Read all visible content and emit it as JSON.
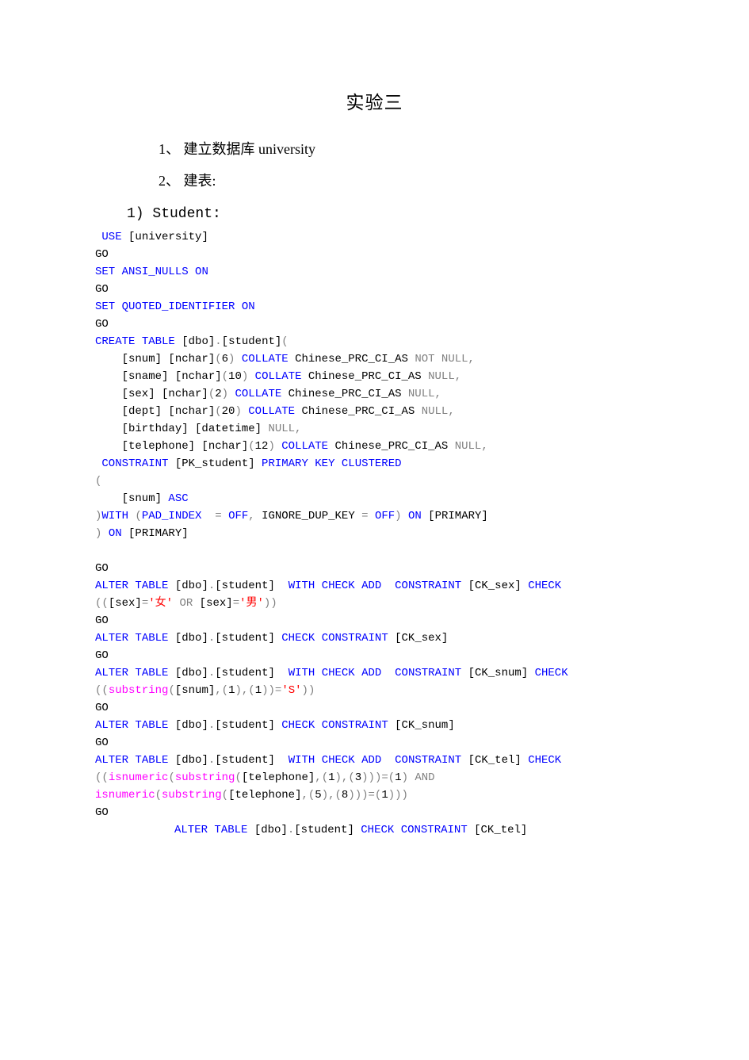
{
  "title": "实验三",
  "items": [
    "1、 建立数据库 university",
    "2、 建表:"
  ],
  "sub": "1) Student:",
  "code": [
    [
      {
        "c": "blk",
        "t": " "
      },
      {
        "c": "kw",
        "t": "USE"
      },
      {
        "c": "blk",
        "t": " [university]"
      }
    ],
    [
      {
        "c": "blk",
        "t": "GO"
      }
    ],
    [
      {
        "c": "kw",
        "t": "SET"
      },
      {
        "c": "blk",
        "t": " "
      },
      {
        "c": "kw",
        "t": "ANSI_NULLS"
      },
      {
        "c": "blk",
        "t": " "
      },
      {
        "c": "kw",
        "t": "ON"
      }
    ],
    [
      {
        "c": "blk",
        "t": "GO"
      }
    ],
    [
      {
        "c": "kw",
        "t": "SET"
      },
      {
        "c": "blk",
        "t": " "
      },
      {
        "c": "kw",
        "t": "QUOTED_IDENTIFIER"
      },
      {
        "c": "blk",
        "t": " "
      },
      {
        "c": "kw",
        "t": "ON"
      }
    ],
    [
      {
        "c": "blk",
        "t": "GO"
      }
    ],
    [
      {
        "c": "kw",
        "t": "CREATE"
      },
      {
        "c": "blk",
        "t": " "
      },
      {
        "c": "kw",
        "t": "TABLE"
      },
      {
        "c": "blk",
        "t": " [dbo]"
      },
      {
        "c": "gray",
        "t": "."
      },
      {
        "c": "blk",
        "t": "[student]"
      },
      {
        "c": "gray",
        "t": "("
      }
    ],
    [
      {
        "c": "blk",
        "t": "    [snum] [nchar]"
      },
      {
        "c": "gray",
        "t": "("
      },
      {
        "c": "blk",
        "t": "6"
      },
      {
        "c": "gray",
        "t": ")"
      },
      {
        "c": "blk",
        "t": " "
      },
      {
        "c": "kw",
        "t": "COLLATE"
      },
      {
        "c": "blk",
        "t": " Chinese_PRC_CI_AS "
      },
      {
        "c": "gray",
        "t": "NOT NULL,"
      }
    ],
    [
      {
        "c": "blk",
        "t": "    [sname] [nchar]"
      },
      {
        "c": "gray",
        "t": "("
      },
      {
        "c": "blk",
        "t": "10"
      },
      {
        "c": "gray",
        "t": ")"
      },
      {
        "c": "blk",
        "t": " "
      },
      {
        "c": "kw",
        "t": "COLLATE"
      },
      {
        "c": "blk",
        "t": " Chinese_PRC_CI_AS "
      },
      {
        "c": "gray",
        "t": "NULL,"
      }
    ],
    [
      {
        "c": "blk",
        "t": "    [sex] [nchar]"
      },
      {
        "c": "gray",
        "t": "("
      },
      {
        "c": "blk",
        "t": "2"
      },
      {
        "c": "gray",
        "t": ")"
      },
      {
        "c": "blk",
        "t": " "
      },
      {
        "c": "kw",
        "t": "COLLATE"
      },
      {
        "c": "blk",
        "t": " Chinese_PRC_CI_AS "
      },
      {
        "c": "gray",
        "t": "NULL,"
      }
    ],
    [
      {
        "c": "blk",
        "t": "    [dept] [nchar]"
      },
      {
        "c": "gray",
        "t": "("
      },
      {
        "c": "blk",
        "t": "20"
      },
      {
        "c": "gray",
        "t": ")"
      },
      {
        "c": "blk",
        "t": " "
      },
      {
        "c": "kw",
        "t": "COLLATE"
      },
      {
        "c": "blk",
        "t": " Chinese_PRC_CI_AS "
      },
      {
        "c": "gray",
        "t": "NULL,"
      }
    ],
    [
      {
        "c": "blk",
        "t": "    [birthday] [datetime] "
      },
      {
        "c": "gray",
        "t": "NULL,"
      }
    ],
    [
      {
        "c": "blk",
        "t": "    [telephone] [nchar]"
      },
      {
        "c": "gray",
        "t": "("
      },
      {
        "c": "blk",
        "t": "12"
      },
      {
        "c": "gray",
        "t": ")"
      },
      {
        "c": "blk",
        "t": " "
      },
      {
        "c": "kw",
        "t": "COLLATE"
      },
      {
        "c": "blk",
        "t": " Chinese_PRC_CI_AS "
      },
      {
        "c": "gray",
        "t": "NULL,"
      }
    ],
    [
      {
        "c": "blk",
        "t": " "
      },
      {
        "c": "kw",
        "t": "CONSTRAINT"
      },
      {
        "c": "blk",
        "t": " [PK_student] "
      },
      {
        "c": "kw",
        "t": "PRIMARY"
      },
      {
        "c": "blk",
        "t": " "
      },
      {
        "c": "kw",
        "t": "KEY"
      },
      {
        "c": "blk",
        "t": " "
      },
      {
        "c": "kw",
        "t": "CLUSTERED"
      }
    ],
    [
      {
        "c": "gray",
        "t": "("
      }
    ],
    [
      {
        "c": "blk",
        "t": "    [snum] "
      },
      {
        "c": "kw",
        "t": "ASC"
      }
    ],
    [
      {
        "c": "gray",
        "t": ")"
      },
      {
        "c": "kw",
        "t": "WITH"
      },
      {
        "c": "blk",
        "t": " "
      },
      {
        "c": "gray",
        "t": "("
      },
      {
        "c": "kw",
        "t": "PAD_INDEX"
      },
      {
        "c": "blk",
        "t": "  "
      },
      {
        "c": "gray",
        "t": "="
      },
      {
        "c": "blk",
        "t": " "
      },
      {
        "c": "kw",
        "t": "OFF"
      },
      {
        "c": "gray",
        "t": ","
      },
      {
        "c": "blk",
        "t": " IGNORE_DUP_KEY "
      },
      {
        "c": "gray",
        "t": "="
      },
      {
        "c": "blk",
        "t": " "
      },
      {
        "c": "kw",
        "t": "OFF"
      },
      {
        "c": "gray",
        "t": ")"
      },
      {
        "c": "blk",
        "t": " "
      },
      {
        "c": "kw",
        "t": "ON"
      },
      {
        "c": "blk",
        "t": " [PRIMARY]"
      }
    ],
    [
      {
        "c": "gray",
        "t": ")"
      },
      {
        "c": "blk",
        "t": " "
      },
      {
        "c": "kw",
        "t": "ON"
      },
      {
        "c": "blk",
        "t": " [PRIMARY]"
      }
    ],
    [
      {
        "c": "blk",
        "t": ""
      }
    ],
    [
      {
        "c": "blk",
        "t": "GO"
      }
    ],
    [
      {
        "c": "kw",
        "t": "ALTER"
      },
      {
        "c": "blk",
        "t": " "
      },
      {
        "c": "kw",
        "t": "TABLE"
      },
      {
        "c": "blk",
        "t": " [dbo]"
      },
      {
        "c": "gray",
        "t": "."
      },
      {
        "c": "blk",
        "t": "[student]  "
      },
      {
        "c": "kw",
        "t": "WITH"
      },
      {
        "c": "blk",
        "t": " "
      },
      {
        "c": "kw",
        "t": "CHECK"
      },
      {
        "c": "blk",
        "t": " "
      },
      {
        "c": "kw",
        "t": "ADD"
      },
      {
        "c": "blk",
        "t": "  "
      },
      {
        "c": "kw",
        "t": "CONSTRAINT"
      },
      {
        "c": "blk",
        "t": " [CK_sex] "
      },
      {
        "c": "kw",
        "t": "CHECK"
      }
    ],
    [
      {
        "c": "gray",
        "t": "(("
      },
      {
        "c": "blk",
        "t": "[sex]"
      },
      {
        "c": "gray",
        "t": "="
      },
      {
        "c": "str",
        "t": "'女'"
      },
      {
        "c": "blk",
        "t": " "
      },
      {
        "c": "gray",
        "t": "OR"
      },
      {
        "c": "blk",
        "t": " [sex]"
      },
      {
        "c": "gray",
        "t": "="
      },
      {
        "c": "str",
        "t": "'男'"
      },
      {
        "c": "gray",
        "t": "))"
      }
    ],
    [
      {
        "c": "blk",
        "t": "GO"
      }
    ],
    [
      {
        "c": "kw",
        "t": "ALTER"
      },
      {
        "c": "blk",
        "t": " "
      },
      {
        "c": "kw",
        "t": "TABLE"
      },
      {
        "c": "blk",
        "t": " [dbo]"
      },
      {
        "c": "gray",
        "t": "."
      },
      {
        "c": "blk",
        "t": "[student] "
      },
      {
        "c": "kw",
        "t": "CHECK"
      },
      {
        "c": "blk",
        "t": " "
      },
      {
        "c": "kw",
        "t": "CONSTRAINT"
      },
      {
        "c": "blk",
        "t": " [CK_sex]"
      }
    ],
    [
      {
        "c": "blk",
        "t": "GO"
      }
    ],
    [
      {
        "c": "kw",
        "t": "ALTER"
      },
      {
        "c": "blk",
        "t": " "
      },
      {
        "c": "kw",
        "t": "TABLE"
      },
      {
        "c": "blk",
        "t": " [dbo]"
      },
      {
        "c": "gray",
        "t": "."
      },
      {
        "c": "blk",
        "t": "[student]  "
      },
      {
        "c": "kw",
        "t": "WITH"
      },
      {
        "c": "blk",
        "t": " "
      },
      {
        "c": "kw",
        "t": "CHECK"
      },
      {
        "c": "blk",
        "t": " "
      },
      {
        "c": "kw",
        "t": "ADD"
      },
      {
        "c": "blk",
        "t": "  "
      },
      {
        "c": "kw",
        "t": "CONSTRAINT"
      },
      {
        "c": "blk",
        "t": " [CK_snum] "
      },
      {
        "c": "kw",
        "t": "CHECK"
      }
    ],
    [
      {
        "c": "gray",
        "t": "(("
      },
      {
        "c": "fn",
        "t": "substring"
      },
      {
        "c": "gray",
        "t": "("
      },
      {
        "c": "blk",
        "t": "[snum]"
      },
      {
        "c": "gray",
        "t": ",("
      },
      {
        "c": "blk",
        "t": "1"
      },
      {
        "c": "gray",
        "t": "),("
      },
      {
        "c": "blk",
        "t": "1"
      },
      {
        "c": "gray",
        "t": "))="
      },
      {
        "c": "str",
        "t": "'S'"
      },
      {
        "c": "gray",
        "t": "))"
      }
    ],
    [
      {
        "c": "blk",
        "t": "GO"
      }
    ],
    [
      {
        "c": "kw",
        "t": "ALTER"
      },
      {
        "c": "blk",
        "t": " "
      },
      {
        "c": "kw",
        "t": "TABLE"
      },
      {
        "c": "blk",
        "t": " [dbo]"
      },
      {
        "c": "gray",
        "t": "."
      },
      {
        "c": "blk",
        "t": "[student] "
      },
      {
        "c": "kw",
        "t": "CHECK"
      },
      {
        "c": "blk",
        "t": " "
      },
      {
        "c": "kw",
        "t": "CONSTRAINT"
      },
      {
        "c": "blk",
        "t": " [CK_snum]"
      }
    ],
    [
      {
        "c": "blk",
        "t": "GO"
      }
    ],
    [
      {
        "c": "kw",
        "t": "ALTER"
      },
      {
        "c": "blk",
        "t": " "
      },
      {
        "c": "kw",
        "t": "TABLE"
      },
      {
        "c": "blk",
        "t": " [dbo]"
      },
      {
        "c": "gray",
        "t": "."
      },
      {
        "c": "blk",
        "t": "[student]  "
      },
      {
        "c": "kw",
        "t": "WITH"
      },
      {
        "c": "blk",
        "t": " "
      },
      {
        "c": "kw",
        "t": "CHECK"
      },
      {
        "c": "blk",
        "t": " "
      },
      {
        "c": "kw",
        "t": "ADD"
      },
      {
        "c": "blk",
        "t": "  "
      },
      {
        "c": "kw",
        "t": "CONSTRAINT"
      },
      {
        "c": "blk",
        "t": " [CK_tel] "
      },
      {
        "c": "kw",
        "t": "CHECK"
      }
    ],
    [
      {
        "c": "gray",
        "t": "(("
      },
      {
        "c": "fn",
        "t": "isnumeric"
      },
      {
        "c": "gray",
        "t": "("
      },
      {
        "c": "fn",
        "t": "substring"
      },
      {
        "c": "gray",
        "t": "("
      },
      {
        "c": "blk",
        "t": "[telephone]"
      },
      {
        "c": "gray",
        "t": ",("
      },
      {
        "c": "blk",
        "t": "1"
      },
      {
        "c": "gray",
        "t": "),("
      },
      {
        "c": "blk",
        "t": "3"
      },
      {
        "c": "gray",
        "t": ")))=("
      },
      {
        "c": "blk",
        "t": "1"
      },
      {
        "c": "gray",
        "t": ")"
      },
      {
        "c": "blk",
        "t": " "
      },
      {
        "c": "gray",
        "t": "AND"
      }
    ],
    [
      {
        "c": "fn",
        "t": "isnumeric"
      },
      {
        "c": "gray",
        "t": "("
      },
      {
        "c": "fn",
        "t": "substring"
      },
      {
        "c": "gray",
        "t": "("
      },
      {
        "c": "blk",
        "t": "[telephone]"
      },
      {
        "c": "gray",
        "t": ",("
      },
      {
        "c": "blk",
        "t": "5"
      },
      {
        "c": "gray",
        "t": "),("
      },
      {
        "c": "blk",
        "t": "8"
      },
      {
        "c": "gray",
        "t": ")))=("
      },
      {
        "c": "blk",
        "t": "1"
      },
      {
        "c": "gray",
        "t": ")))"
      }
    ],
    [
      {
        "c": "blk",
        "t": "GO"
      }
    ]
  ],
  "last_line": [
    {
      "c": "kw",
      "t": "ALTER"
    },
    {
      "c": "blk",
      "t": " "
    },
    {
      "c": "kw",
      "t": "TABLE"
    },
    {
      "c": "blk",
      "t": " [dbo]"
    },
    {
      "c": "gray",
      "t": "."
    },
    {
      "c": "blk",
      "t": "[student] "
    },
    {
      "c": "kw",
      "t": "CHECK"
    },
    {
      "c": "blk",
      "t": " "
    },
    {
      "c": "kw",
      "t": "CONSTRAINT"
    },
    {
      "c": "blk",
      "t": " [CK_tel]"
    }
  ]
}
